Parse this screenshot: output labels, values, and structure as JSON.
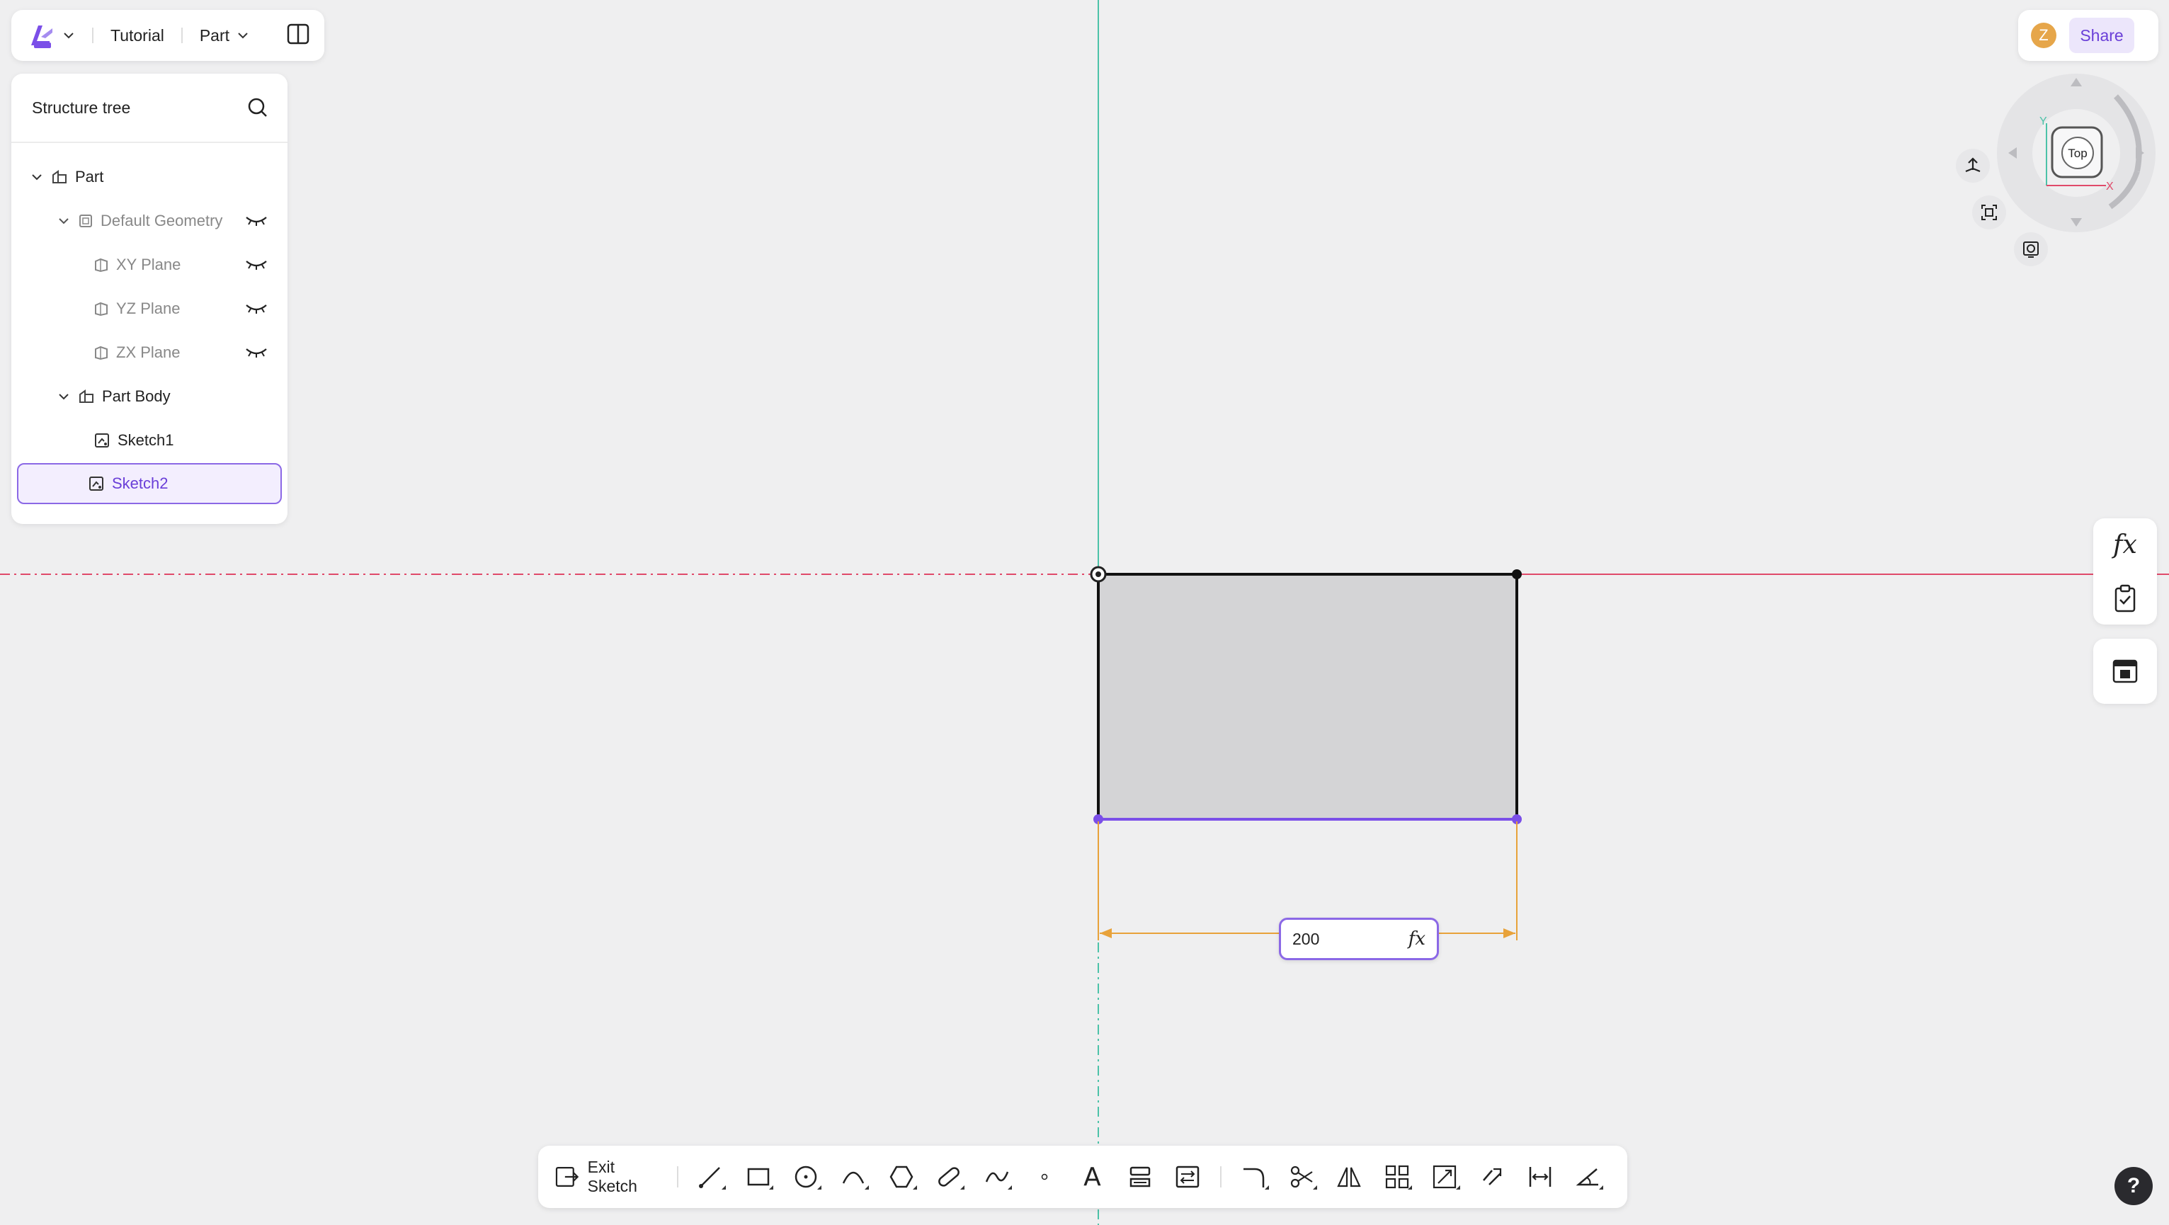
{
  "header": {
    "app_menu_icon": "app-logo-icon",
    "breadcrumb_project": "Tutorial",
    "document_type": "Part"
  },
  "structure_tree": {
    "title": "Structure tree",
    "items": [
      {
        "label": "Part"
      },
      {
        "label": "Default Geometry"
      },
      {
        "label": "XY Plane"
      },
      {
        "label": "YZ Plane"
      },
      {
        "label": "ZX Plane"
      },
      {
        "label": "Part Body"
      },
      {
        "label": "Sketch1"
      },
      {
        "label": "Sketch2",
        "selected": true
      }
    ]
  },
  "user": {
    "avatar_initial": "Z",
    "share_label": "Share"
  },
  "viewcube": {
    "face_label": "Top",
    "axis_y": "Y",
    "axis_x": "X"
  },
  "side_panel": {
    "formula_label": "fx"
  },
  "dimension": {
    "value": "200",
    "fx_label": "fx"
  },
  "toolbar": {
    "exit_label": "Exit Sketch",
    "text_tool_label": "A"
  },
  "help_label": "?",
  "colors": {
    "accent": "#8b68e6",
    "x_axis": "#e04a6a",
    "y_axis": "#4cc2a8",
    "dimension": "#e8a23a"
  }
}
